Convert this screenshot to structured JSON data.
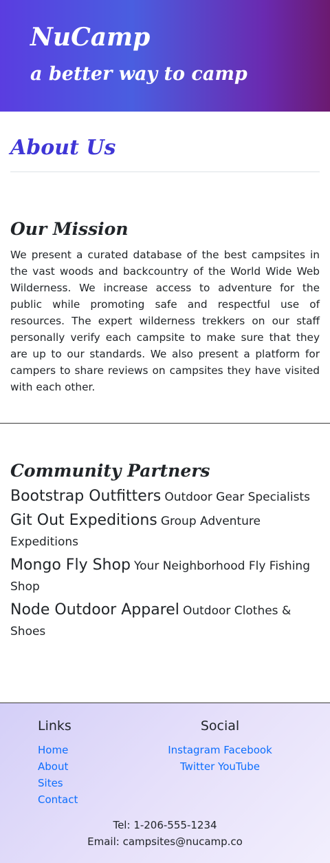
{
  "header": {
    "brand": "NuCamp",
    "tagline": "a better way to camp"
  },
  "about": {
    "title": "About Us"
  },
  "mission": {
    "title": "Our Mission",
    "text": "We present a curated database of the best campsites in the vast woods and backcountry of the World Wide Web Wilderness. We increase access to adventure for the public while promoting safe and respectful use of resources. The expert wilderness trekkers on our staff personally verify each campsite to make sure that they are up to our standards. We also present a platform for campers to share reviews on campsites they have visited with each other."
  },
  "partners": {
    "title": "Community Partners",
    "items": [
      {
        "name": "Bootstrap Outfitters",
        "desc": "Outdoor Gear Specialists"
      },
      {
        "name": "Git Out Expeditions",
        "desc": "Group Adventure Expeditions"
      },
      {
        "name": "Mongo Fly Shop",
        "desc": "Your Neighborhood Fly Fishing Shop"
      },
      {
        "name": "Node Outdoor Apparel",
        "desc": "Outdoor Clothes & Shoes"
      }
    ]
  },
  "footer": {
    "links_title": "Links",
    "links": [
      "Home",
      "About",
      "Sites",
      "Contact"
    ],
    "social_title": "Social",
    "social_row1": [
      "Instagram",
      "Facebook"
    ],
    "social_row2": [
      "Twitter",
      "YouTube"
    ],
    "tel_label": "Tel:",
    "tel": "1-206-555-1234",
    "email_label": "Email:",
    "email": "campsites@nucamp.co"
  },
  "colors": {
    "accent": "#3f36d6",
    "link": "#0d6efd"
  }
}
